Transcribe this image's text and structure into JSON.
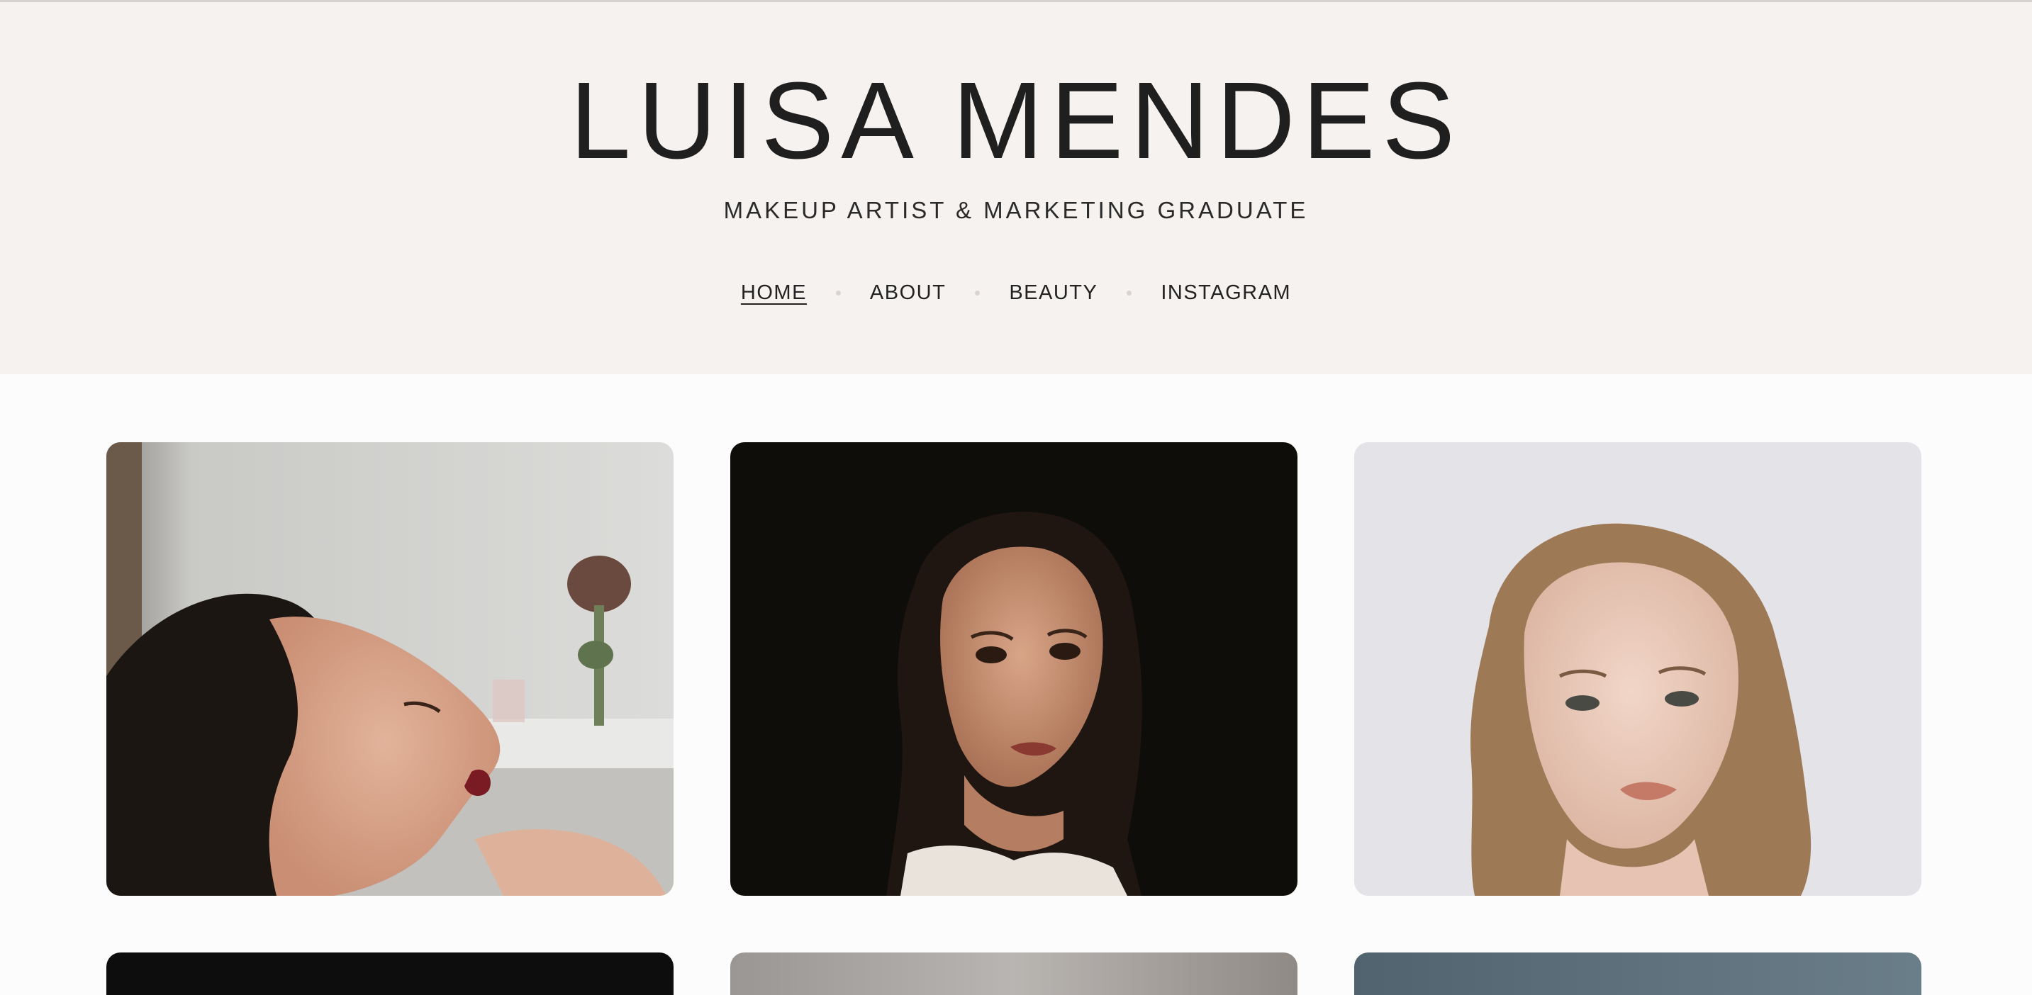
{
  "header": {
    "title": "LUISA MENDES",
    "tagline": "MAKEUP ARTIST & MARKETING GRADUATE"
  },
  "nav": {
    "items": [
      {
        "label": "HOME",
        "active": true
      },
      {
        "label": "ABOUT",
        "active": false
      },
      {
        "label": "BEAUTY",
        "active": false
      },
      {
        "label": "INSTAGRAM",
        "active": false
      }
    ]
  },
  "colors": {
    "header_bg": "#f6f2f0",
    "page_bg": "#fcfcfc",
    "text": "#1f1f1f"
  }
}
